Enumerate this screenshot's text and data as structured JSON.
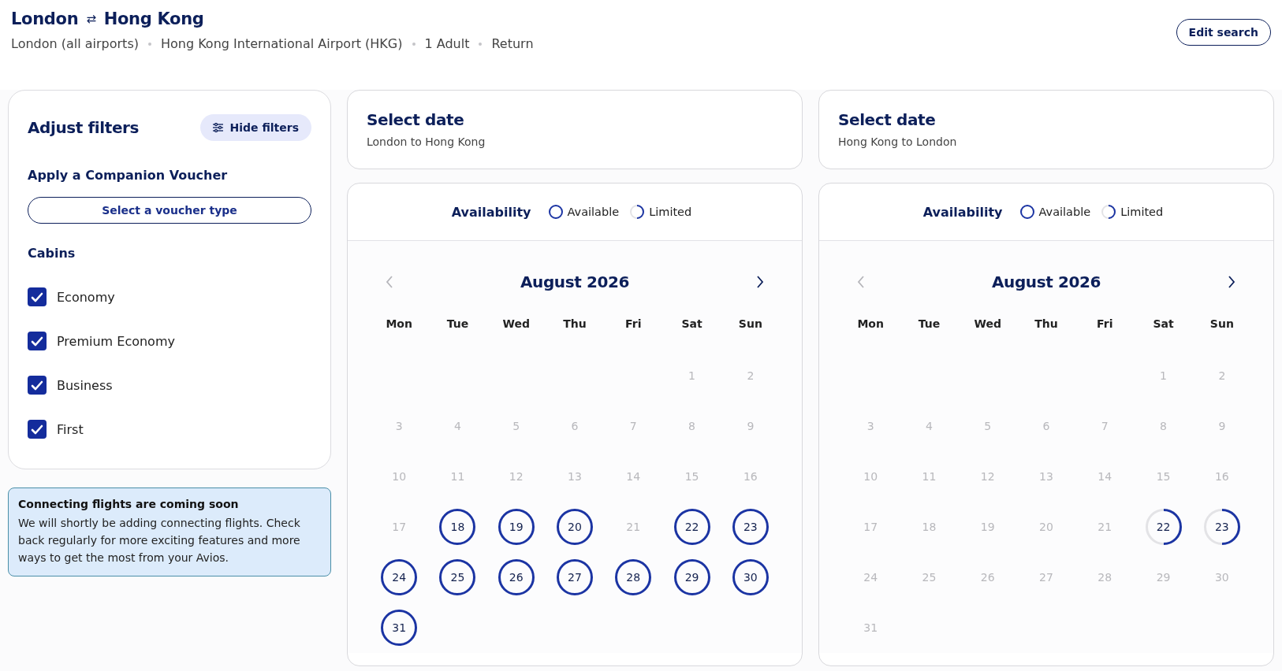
{
  "header": {
    "origin": "London",
    "swap_icon": "⇄",
    "destination": "Hong Kong",
    "details": [
      "London (all airports)",
      "Hong Kong International Airport (HKG)",
      "1 Adult",
      "Return"
    ],
    "edit_button": "Edit search"
  },
  "filters": {
    "title": "Adjust filters",
    "hide_button": "Hide filters",
    "voucher_heading": "Apply a Companion Voucher",
    "voucher_button": "Select a voucher type",
    "cabins_heading": "Cabins",
    "cabins": [
      {
        "label": "Economy",
        "checked": true
      },
      {
        "label": "Premium Economy",
        "checked": true
      },
      {
        "label": "Business",
        "checked": true
      },
      {
        "label": "First",
        "checked": true
      }
    ]
  },
  "notice": {
    "title": "Connecting flights are coming soon",
    "text": "We will shortly be adding connecting flights. Check back regularly for more exciting features and more ways to get the most from your Avios."
  },
  "journeys": [
    {
      "title": "Select date",
      "subtitle": "London to Hong Kong",
      "legend": {
        "title": "Availability",
        "available": "Available",
        "limited": "Limited"
      },
      "month": "August 2026",
      "previous_disabled": true,
      "next_disabled": false,
      "weekdays": [
        "Mon",
        "Tue",
        "Wed",
        "Thu",
        "Fri",
        "Sat",
        "Sun"
      ],
      "weeks": [
        [
          {
            "day": "1",
            "kind": "unavailable"
          },
          {
            "day": "2",
            "kind": "unavailable"
          }
        ],
        [
          {
            "day": "3",
            "kind": "unavailable"
          },
          {
            "day": "4",
            "kind": "unavailable"
          },
          {
            "day": "5",
            "kind": "unavailable"
          },
          {
            "day": "6",
            "kind": "unavailable"
          },
          {
            "day": "7",
            "kind": "unavailable"
          },
          {
            "day": "8",
            "kind": "unavailable"
          },
          {
            "day": "9",
            "kind": "unavailable"
          }
        ],
        [
          {
            "day": "10",
            "kind": "unavailable"
          },
          {
            "day": "11",
            "kind": "unavailable"
          },
          {
            "day": "12",
            "kind": "unavailable"
          },
          {
            "day": "13",
            "kind": "unavailable"
          },
          {
            "day": "14",
            "kind": "unavailable"
          },
          {
            "day": "15",
            "kind": "unavailable"
          },
          {
            "day": "16",
            "kind": "unavailable"
          }
        ],
        [
          {
            "day": "17",
            "kind": "unavailable"
          },
          {
            "day": "18",
            "kind": "available"
          },
          {
            "day": "19",
            "kind": "available"
          },
          {
            "day": "20",
            "kind": "available"
          },
          {
            "day": "21",
            "kind": "unavailable"
          },
          {
            "day": "22",
            "kind": "available"
          },
          {
            "day": "23",
            "kind": "available"
          }
        ],
        [
          {
            "day": "24",
            "kind": "available"
          },
          {
            "day": "25",
            "kind": "available"
          },
          {
            "day": "26",
            "kind": "available"
          },
          {
            "day": "27",
            "kind": "available"
          },
          {
            "day": "28",
            "kind": "available"
          },
          {
            "day": "29",
            "kind": "available"
          },
          {
            "day": "30",
            "kind": "available"
          }
        ],
        [
          {
            "day": "31",
            "kind": "available"
          }
        ]
      ]
    },
    {
      "title": "Select date",
      "subtitle": "Hong Kong to London",
      "legend": {
        "title": "Availability",
        "available": "Available",
        "limited": "Limited"
      },
      "month": "August 2026",
      "previous_disabled": true,
      "next_disabled": false,
      "weekdays": [
        "Mon",
        "Tue",
        "Wed",
        "Thu",
        "Fri",
        "Sat",
        "Sun"
      ],
      "weeks": [
        [
          {
            "day": "1",
            "kind": "unavailable"
          },
          {
            "day": "2",
            "kind": "unavailable"
          }
        ],
        [
          {
            "day": "3",
            "kind": "unavailable"
          },
          {
            "day": "4",
            "kind": "unavailable"
          },
          {
            "day": "5",
            "kind": "unavailable"
          },
          {
            "day": "6",
            "kind": "unavailable"
          },
          {
            "day": "7",
            "kind": "unavailable"
          },
          {
            "day": "8",
            "kind": "unavailable"
          },
          {
            "day": "9",
            "kind": "unavailable"
          }
        ],
        [
          {
            "day": "10",
            "kind": "unavailable"
          },
          {
            "day": "11",
            "kind": "unavailable"
          },
          {
            "day": "12",
            "kind": "unavailable"
          },
          {
            "day": "13",
            "kind": "unavailable"
          },
          {
            "day": "14",
            "kind": "unavailable"
          },
          {
            "day": "15",
            "kind": "unavailable"
          },
          {
            "day": "16",
            "kind": "unavailable"
          }
        ],
        [
          {
            "day": "17",
            "kind": "unavailable"
          },
          {
            "day": "18",
            "kind": "unavailable"
          },
          {
            "day": "19",
            "kind": "unavailable"
          },
          {
            "day": "20",
            "kind": "unavailable"
          },
          {
            "day": "21",
            "kind": "unavailable"
          },
          {
            "day": "22",
            "kind": "limited"
          },
          {
            "day": "23",
            "kind": "limited"
          }
        ],
        [
          {
            "day": "24",
            "kind": "unavailable"
          },
          {
            "day": "25",
            "kind": "unavailable"
          },
          {
            "day": "26",
            "kind": "unavailable"
          },
          {
            "day": "27",
            "kind": "unavailable"
          },
          {
            "day": "28",
            "kind": "unavailable"
          },
          {
            "day": "29",
            "kind": "unavailable"
          },
          {
            "day": "30",
            "kind": "unavailable"
          }
        ],
        [
          {
            "day": "31",
            "kind": "unavailable"
          }
        ]
      ]
    }
  ]
}
